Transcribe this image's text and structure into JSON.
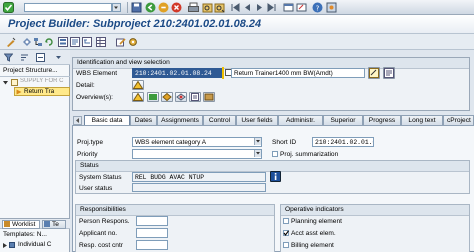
{
  "page_title": "Project Builder: Subproject 210:2401.02.01.08.24",
  "nav_tree": {
    "header": "Project Structure...",
    "root_item": "SUPPLY FOR C",
    "child_item": "Return Tra"
  },
  "worklist": {
    "tab_worklist": "Worklist",
    "tab_templates": "Te",
    "templates_header": "Templates: N...",
    "individual_item": "Individual C"
  },
  "ident": {
    "section_title": "Identification and view selection",
    "wbs_label": "WBS Element",
    "wbs_value": "210:2401.02.01.08.24",
    "wbs_desc": "Return Trainer1400 mm BW(Amdt)",
    "detail_label": "Detail:",
    "overviews_label": "Overview(s):"
  },
  "tabs": [
    {
      "label": "Basic data"
    },
    {
      "label": "Dates"
    },
    {
      "label": "Assignments"
    },
    {
      "label": "Control"
    },
    {
      "label": "User fields"
    },
    {
      "label": "Administr."
    },
    {
      "label": "Superior"
    },
    {
      "label": "Progress"
    },
    {
      "label": "Long text"
    },
    {
      "label": "cProject"
    }
  ],
  "basic": {
    "proj_type_label": "Proj.type",
    "proj_type_value": "WBS element category A",
    "priority_label": "Priority",
    "short_id_label": "Short ID",
    "short_id_value": "210:2401.02.01.0",
    "proj_summ_label": "Proj. summarization",
    "status_title": "Status",
    "system_status_label": "System Status",
    "system_status_value": "REL  BUDG AVAC NTUP",
    "user_status_label": "User status",
    "resp_title": "Responsibilities",
    "person_resp_label": "Person Respons.",
    "applicant_label": "Applicant no.",
    "resp_cost_label": "Resp. cost cntr",
    "op_title": "Operative indicators",
    "planning_label": "Planning element",
    "acct_label": "Acct asst elem.",
    "billing_label": "Billing element"
  },
  "colors": {
    "title_blue": "#1b4a86",
    "sap_bg": "#dfe6ee",
    "highlight_yellow": "#ffe98a",
    "selection_blue": "#2f5a94"
  }
}
